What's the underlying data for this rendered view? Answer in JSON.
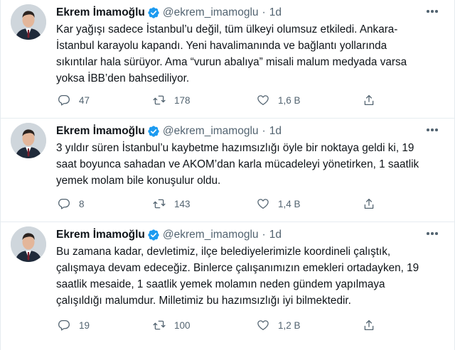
{
  "tweets": [
    {
      "author": "Ekrem İmamoğlu",
      "handle": "@ekrem_imamoglu",
      "separator": "·",
      "time": "1d",
      "text": "Kar yağışı sadece İstanbul’u değil, tüm ülkeyi olumsuz etkiledi. Ankara-\nİstanbul karayolu kapandı. Yeni havalimanında ve bağlantı yollarında\nsıkıntılar hala sürüyor. Ama “vurun abalıya” misali malum medyada varsa\nyoksa İBB’den bahsediliyor.",
      "replies": "47",
      "retweets": "178",
      "likes": "1,6 B"
    },
    {
      "author": "Ekrem İmamoğlu",
      "handle": "@ekrem_imamoglu",
      "separator": "·",
      "time": "1d",
      "text": "3 yıldır süren İstanbul’u kaybetme hazımsızlığı öyle bir noktaya geldi ki, 19\nsaat boyunca sahadan ve AKOM’dan karla mücadeleyi yönetirken, 1 saatlik\nyemek molam bile konuşulur oldu.",
      "replies": "8",
      "retweets": "143",
      "likes": "1,4 B"
    },
    {
      "author": "Ekrem İmamoğlu",
      "handle": "@ekrem_imamoglu",
      "separator": "·",
      "time": "1d",
      "text": "Bu zamana kadar, devletimiz, ilçe belediyelerimizle koordineli çalıştık,\nçalışmaya devam edeceğiz. Binlerce çalışanımızın emekleri ortadayken, 19\nsaatlik mesaide, 1 saatlik yemek molamın neden gündem yapılmaya\nçalışıldığı malumdur. Milletimiz bu hazımsızlığı iyi bilmektedir.",
      "replies": "19",
      "retweets": "100",
      "likes": "1,2 B"
    }
  ],
  "icons": {
    "verified": "verified-badge-icon",
    "more": "more-options-icon",
    "reply": "reply-icon",
    "retweet": "retweet-icon",
    "like": "heart-icon",
    "share": "share-icon"
  },
  "colors": {
    "verified": "#1d9bf0",
    "secondary_text": "#536471",
    "primary_text": "#0f1419",
    "divider": "#e6ecf0"
  }
}
